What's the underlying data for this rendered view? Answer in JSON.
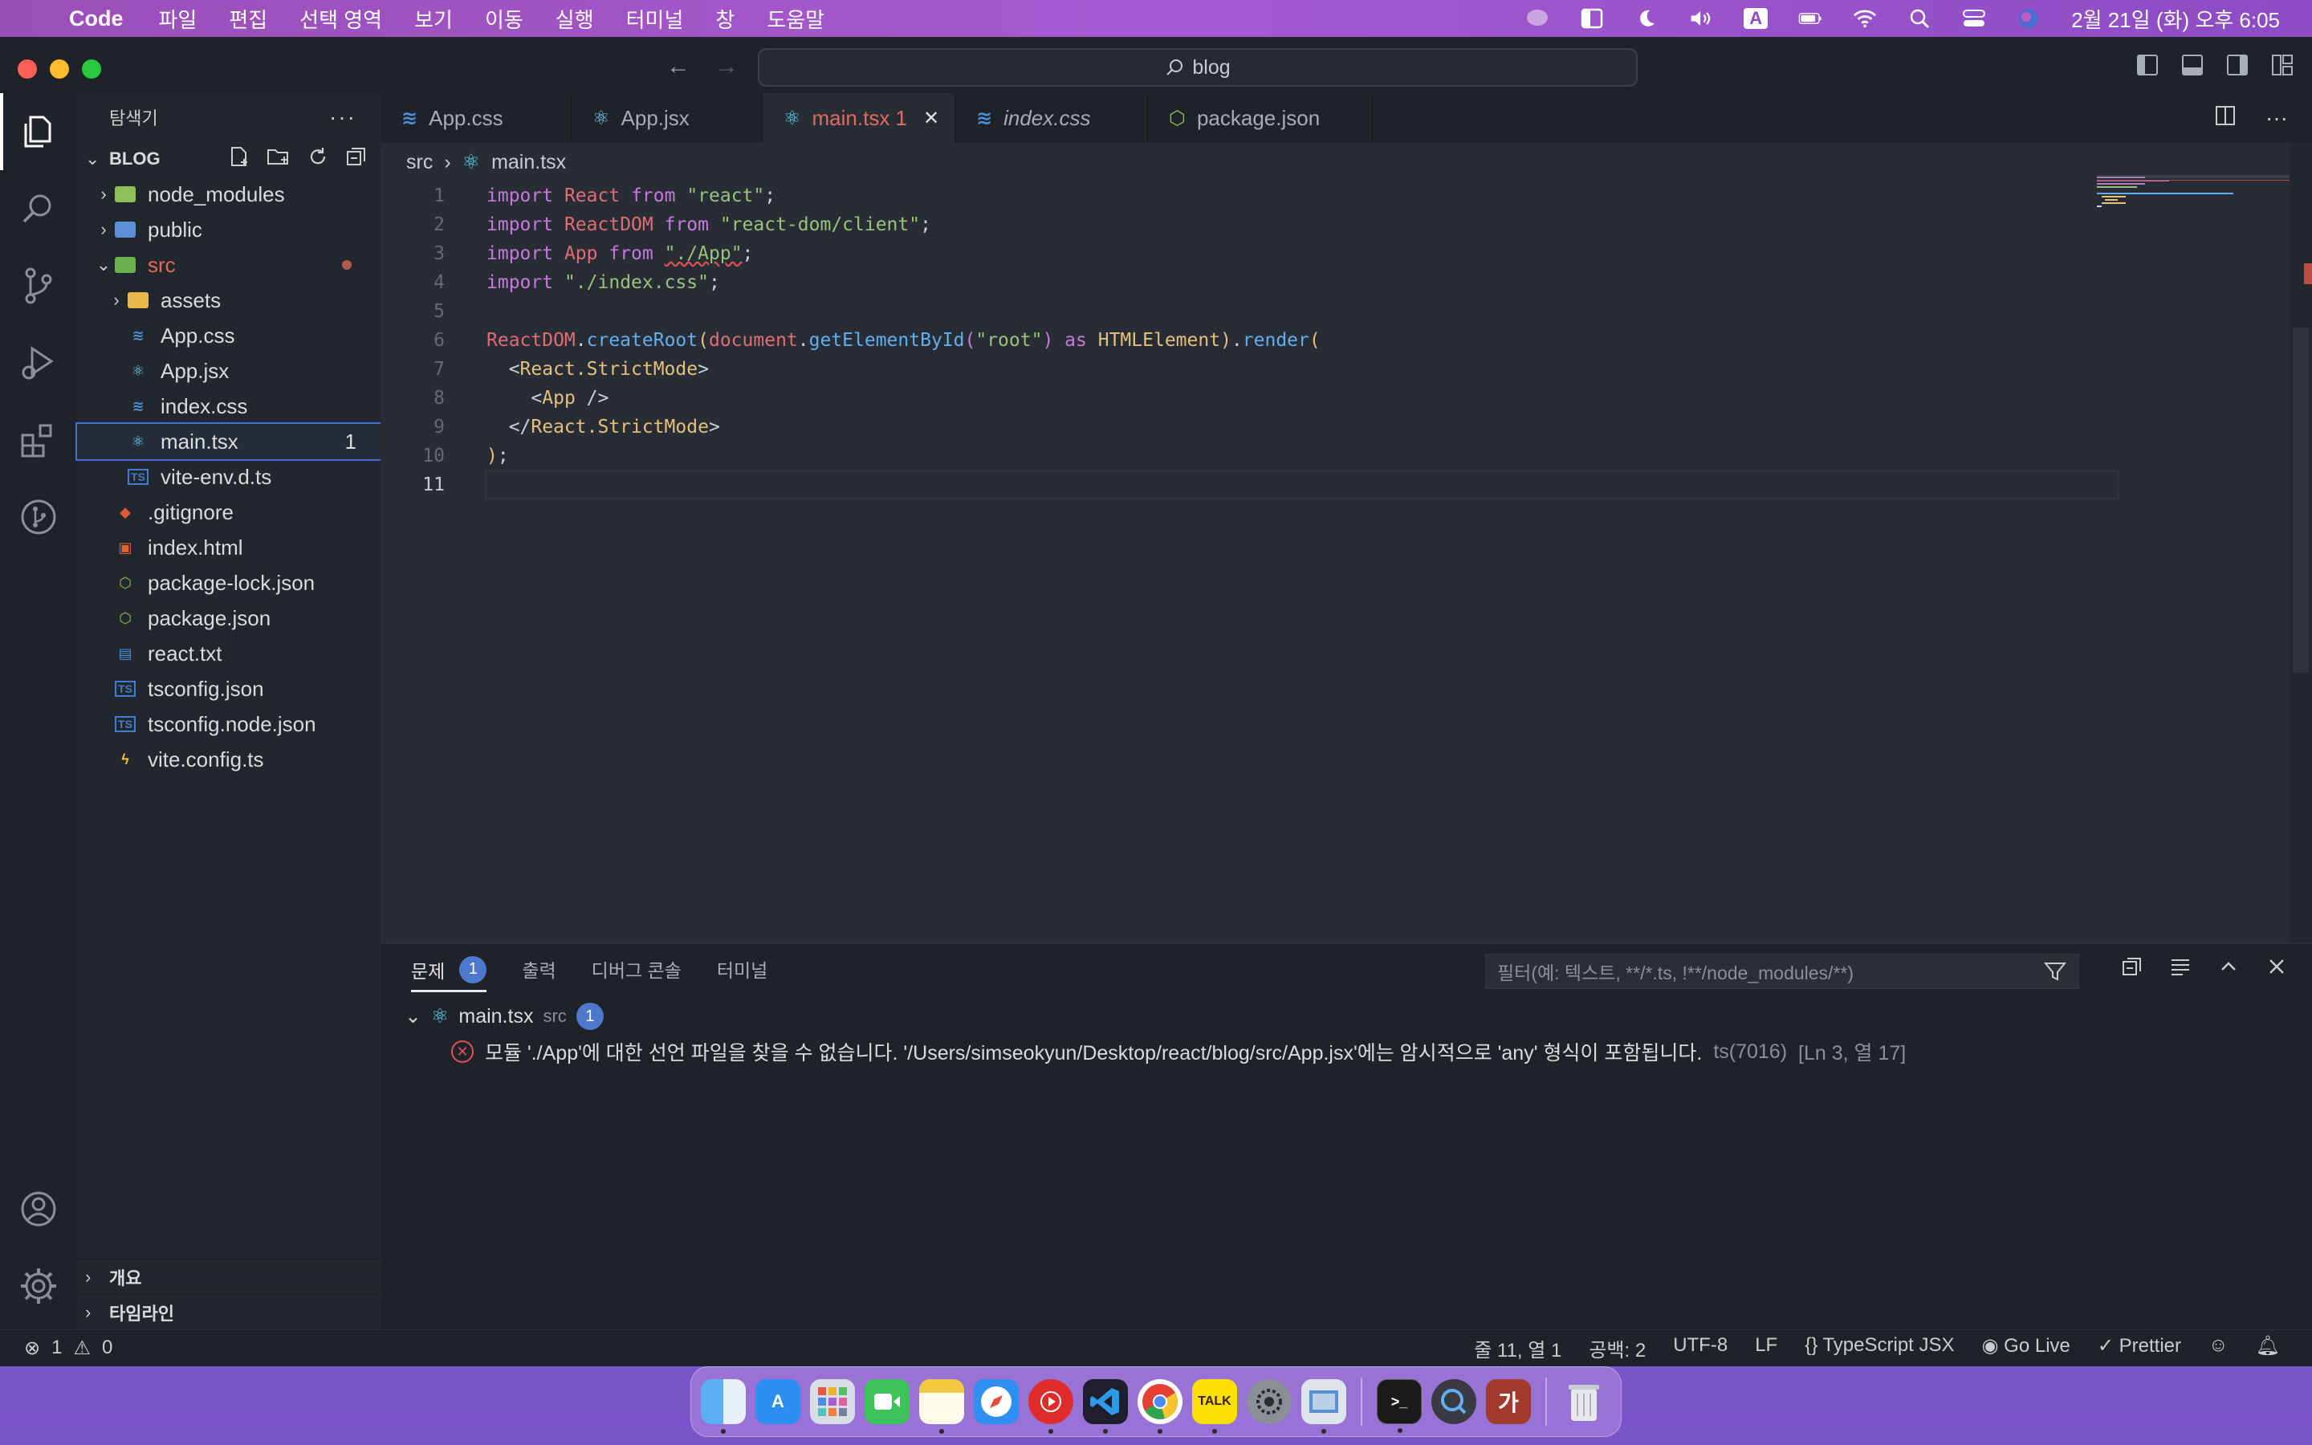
{
  "menubar": {
    "app_name": "Code",
    "items": [
      "파일",
      "편집",
      "선택 영역",
      "보기",
      "이동",
      "실행",
      "터미널",
      "창",
      "도움말"
    ],
    "input_indicator": "A",
    "clock": "2월 21일 (화) 오후 6:05"
  },
  "window": {
    "search_text": "blog"
  },
  "sidebar": {
    "title": "탐색기",
    "section_title": "BLOG",
    "items": [
      {
        "label": "node_modules",
        "type": "folder",
        "depth": 0,
        "expanded": false,
        "color": "#8dbf5b"
      },
      {
        "label": "public",
        "type": "folder",
        "depth": 0,
        "expanded": false,
        "color": "#5b8fd6"
      },
      {
        "label": "src",
        "type": "folder",
        "depth": 0,
        "expanded": true,
        "color": "#6ab04c",
        "modified": true
      },
      {
        "label": "assets",
        "type": "folder",
        "depth": 1,
        "expanded": false,
        "color": "#e8b84a"
      },
      {
        "label": "App.css",
        "type": "css",
        "depth": 1
      },
      {
        "label": "App.jsx",
        "type": "react",
        "depth": 1
      },
      {
        "label": "index.css",
        "type": "css",
        "depth": 1
      },
      {
        "label": "main.tsx",
        "type": "react",
        "depth": 1,
        "selected": true,
        "problems": "1"
      },
      {
        "label": "vite-env.d.ts",
        "type": "ts",
        "depth": 1
      },
      {
        "label": ".gitignore",
        "type": "git",
        "depth": 0
      },
      {
        "label": "index.html",
        "type": "html",
        "depth": 0
      },
      {
        "label": "package-lock.json",
        "type": "npm",
        "depth": 0
      },
      {
        "label": "package.json",
        "type": "npm",
        "depth": 0
      },
      {
        "label": "react.txt",
        "type": "txt",
        "depth": 0
      },
      {
        "label": "tsconfig.json",
        "type": "ts",
        "depth": 0
      },
      {
        "label": "tsconfig.node.json",
        "type": "ts",
        "depth": 0
      },
      {
        "label": "vite.config.ts",
        "type": "vite",
        "depth": 0
      }
    ],
    "bottom_sections": [
      "개요",
      "타임라인"
    ]
  },
  "tabs": [
    {
      "label": "App.css",
      "type": "css"
    },
    {
      "label": "App.jsx",
      "type": "react"
    },
    {
      "label": "main.tsx 1",
      "type": "react",
      "active": true
    },
    {
      "label": "index.css",
      "type": "css"
    },
    {
      "label": "package.json",
      "type": "npm"
    }
  ],
  "editor": {
    "breadcrumb": [
      "src",
      "main.tsx"
    ],
    "line_numbers": [
      "1",
      "2",
      "3",
      "4",
      "5",
      "6",
      "7",
      "8",
      "9",
      "10",
      "11"
    ],
    "current_line": "11"
  },
  "panel": {
    "tabs": [
      "문제",
      "출력",
      "디버그 콘솔",
      "터미널"
    ],
    "problem_count": "1",
    "filter_placeholder": "필터(예: 텍스트, **/*.ts, !**/node_modules/**)",
    "problem_file": "main.tsx",
    "problem_file_dir": "src",
    "problem_file_count": "1",
    "problem_message": "모듈 './App'에 대한 선언 파일을 찾을 수 없습니다. '/Users/simseokyun/Desktop/react/blog/src/App.jsx'에는 암시적으로 'any' 형식이 포함됩니다.",
    "problem_code": "ts(7016)",
    "problem_location": "[Ln 3, 열 17]"
  },
  "statusbar": {
    "errors": "1",
    "warnings": "0",
    "position": "줄 11, 열 1",
    "spaces": "공백: 2",
    "encoding": "UTF-8",
    "eol": "LF",
    "language": "TypeScript JSX",
    "golive": "Go Live",
    "prettier": "Prettier"
  },
  "dock": {
    "apps": [
      "finder",
      "app-store",
      "launchpad",
      "facetime",
      "notes",
      "safari",
      "youtube-music",
      "vscode",
      "chrome",
      "kakaotalk",
      "system-settings",
      "preview",
      "terminal",
      "quicktime",
      "dictionary",
      "trash"
    ],
    "kakaotalk_label": "TALK",
    "dictionary_label": "가"
  }
}
